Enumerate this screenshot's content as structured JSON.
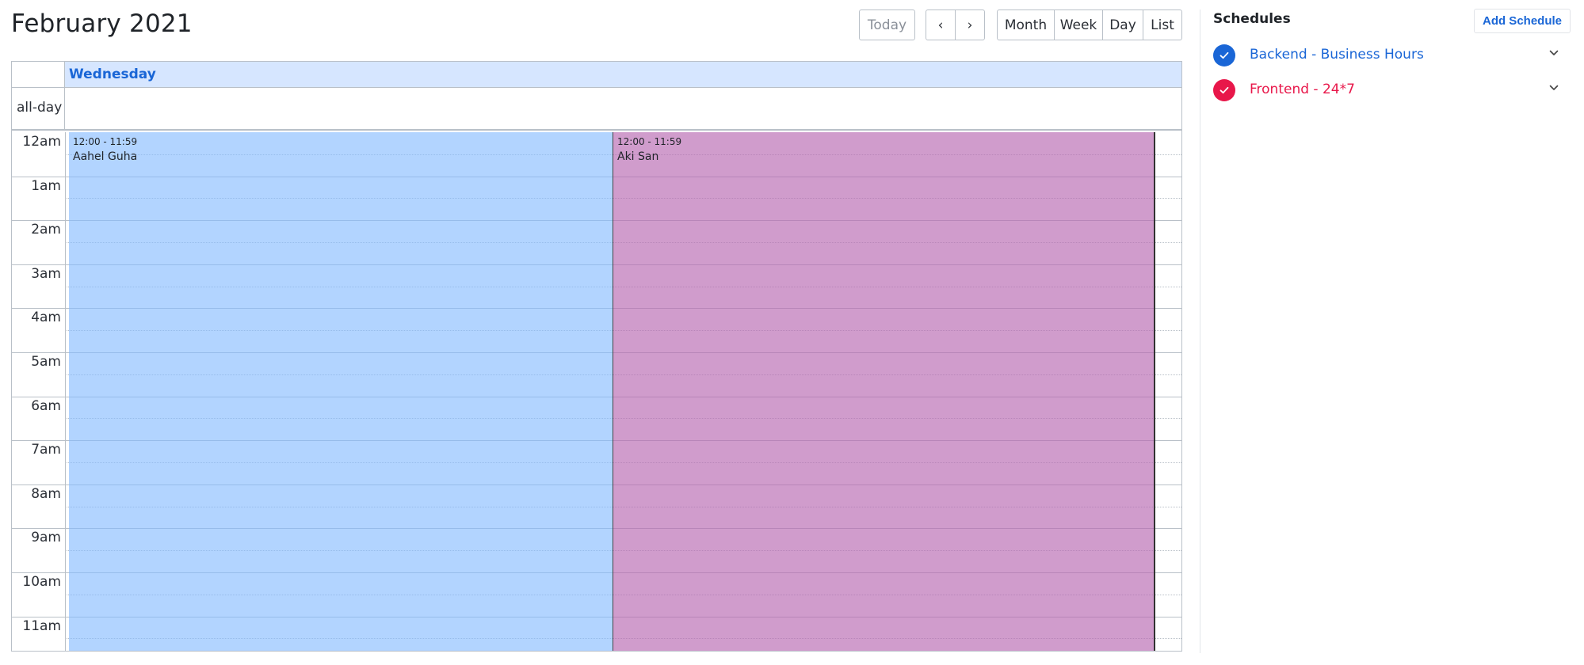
{
  "header": {
    "title": "February 2021",
    "buttons": {
      "today": "Today",
      "prev": "‹",
      "next": "›",
      "month": "Month",
      "week": "Week",
      "day": "Day",
      "list": "List"
    }
  },
  "calendar": {
    "day_header": "Wednesday",
    "allday_label": "all-day",
    "hours": [
      "12am",
      "1am",
      "2am",
      "3am",
      "4am",
      "5am",
      "6am",
      "7am",
      "8am",
      "9am",
      "10am",
      "11am"
    ],
    "events": [
      {
        "time": "12:00 - 11:59",
        "name": "Aahel Guha",
        "color": "#83b9ff"
      },
      {
        "time": "12:00 - 11:59",
        "name": "Aki San",
        "color": "#b767b0"
      }
    ]
  },
  "sidebar": {
    "title": "Schedules",
    "add_label": "Add Schedule",
    "schedules": [
      {
        "name": "Backend - Business Hours",
        "color": "#1a66d6",
        "checked": true,
        "icon": "check-icon"
      },
      {
        "name": "Frontend - 24*7",
        "color": "#e8174a",
        "checked": true,
        "icon": "check-icon"
      }
    ],
    "chevron_icon": "chevron-down-icon"
  }
}
